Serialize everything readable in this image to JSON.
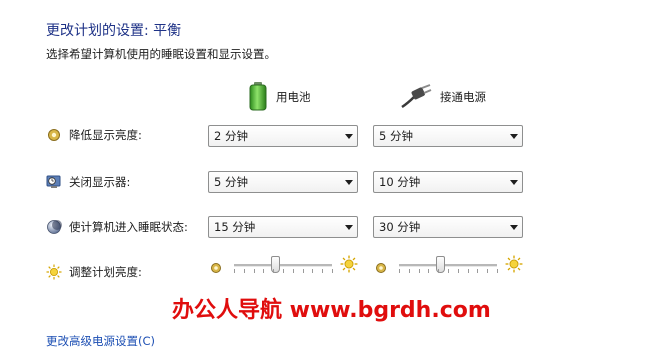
{
  "header": {
    "title": "更改计划的设置: 平衡",
    "subtitle": "选择希望计算机使用的睡眠设置和显示设置。"
  },
  "columns": {
    "battery": "用电池",
    "plugged": "接通电源"
  },
  "rows": [
    {
      "label": "降低显示亮度:",
      "battery": "2 分钟",
      "plugged": "5 分钟"
    },
    {
      "label": "关闭显示器:",
      "battery": "5 分钟",
      "plugged": "10 分钟"
    },
    {
      "label": "使计算机进入睡眠状态:",
      "battery": "15 分钟",
      "plugged": "30 分钟"
    }
  ],
  "brightness": {
    "label": "调整计划亮度:",
    "battery_level": 0.42,
    "plugged_level": 0.42
  },
  "watermark": "办公人导航 www.bgrdh.com",
  "links": {
    "advanced": "更改高级电源设置(C)"
  },
  "colors": {
    "title": "#1e3287",
    "link": "#1e50b4",
    "watermark": "#e00d0d"
  },
  "icons": [
    "battery-icon",
    "power-plug-icon",
    "dim-display-icon",
    "display-off-icon",
    "sleep-icon",
    "brightness-icon"
  ]
}
